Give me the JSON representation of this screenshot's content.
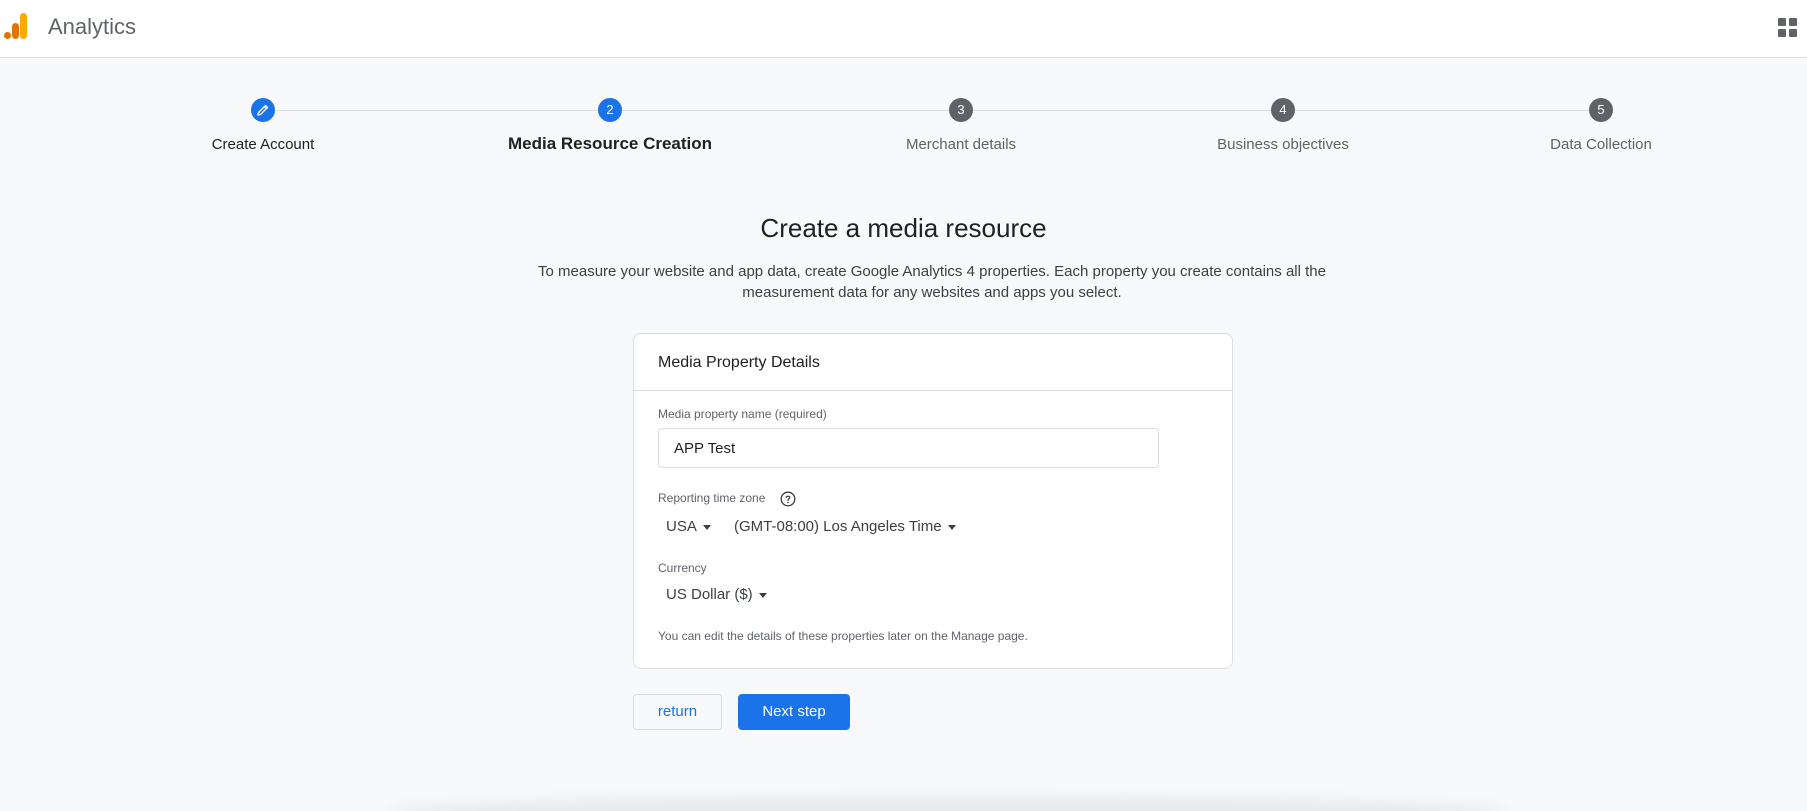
{
  "header": {
    "app_title": "Analytics",
    "logo_icon": "analytics-logo",
    "apps_icon": "apps-grid-icon"
  },
  "stepper": {
    "steps": [
      {
        "number": "",
        "label": "Create Account",
        "state": "done",
        "icon": "pencil-icon"
      },
      {
        "number": "2",
        "label": "Media Resource Creation",
        "state": "active"
      },
      {
        "number": "3",
        "label": "Merchant details",
        "state": "upcoming"
      },
      {
        "number": "4",
        "label": "Business objectives",
        "state": "upcoming"
      },
      {
        "number": "5",
        "label": "Data Collection",
        "state": "upcoming"
      }
    ]
  },
  "main": {
    "title": "Create a media resource",
    "description": "To measure your website and app data, create Google Analytics 4 properties. Each property you create contains all the measurement data for any websites and apps you select."
  },
  "card": {
    "title": "Media Property Details",
    "name_label": "Media property name (required)",
    "name_value": "APP Test",
    "timezone_label": "Reporting time zone",
    "country_value": "USA",
    "timezone_value": "(GMT-08:00) Los Angeles Time",
    "currency_label": "Currency",
    "currency_value": "US Dollar ($)",
    "note": "You can edit the details of these properties later on the Manage page."
  },
  "actions": {
    "return_label": "return",
    "next_label": "Next step"
  },
  "colors": {
    "primary": "#1a73e8",
    "step_inactive": "#5f6368",
    "logo_orange": "#f9ab00",
    "logo_dark_orange": "#e37400"
  }
}
